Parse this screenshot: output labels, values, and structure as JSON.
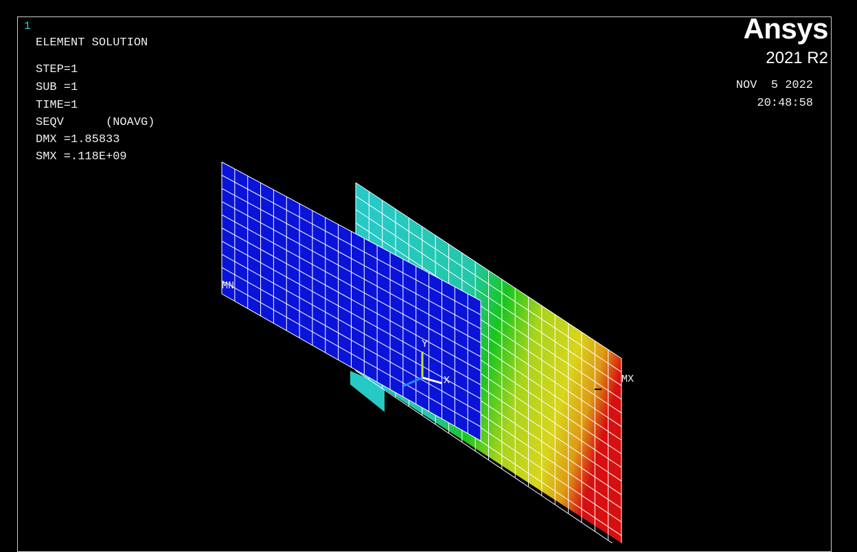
{
  "window_number": "1",
  "header": {
    "title": "ELEMENT SOLUTION",
    "step": "STEP=1",
    "sub": "SUB =1",
    "time": "TIME=1",
    "seqv": "SEQV      (NOAVG)",
    "dmx": "DMX =1.85833",
    "smx": "SMX =.118E+09"
  },
  "logo": {
    "brand": "Ansys",
    "version": "2021 R2"
  },
  "timestamp": {
    "date": "NOV  5 2022",
    "time": "20:48:58"
  },
  "markers": {
    "min": "MN",
    "max": "MX",
    "axis_x": "X",
    "axis_y": "Y"
  },
  "colors": {
    "background": "#000000",
    "mesh_line": "#ffffff",
    "front_plate": "#0a14d8",
    "contour_blue": "#0a14d8",
    "contour_cyan": "#27c9c4",
    "contour_green": "#18c51e",
    "contour_yellowgreen": "#a8d41b",
    "contour_yellow": "#d9d51c",
    "contour_orange": "#dd9a16",
    "contour_red": "#d61010"
  }
}
